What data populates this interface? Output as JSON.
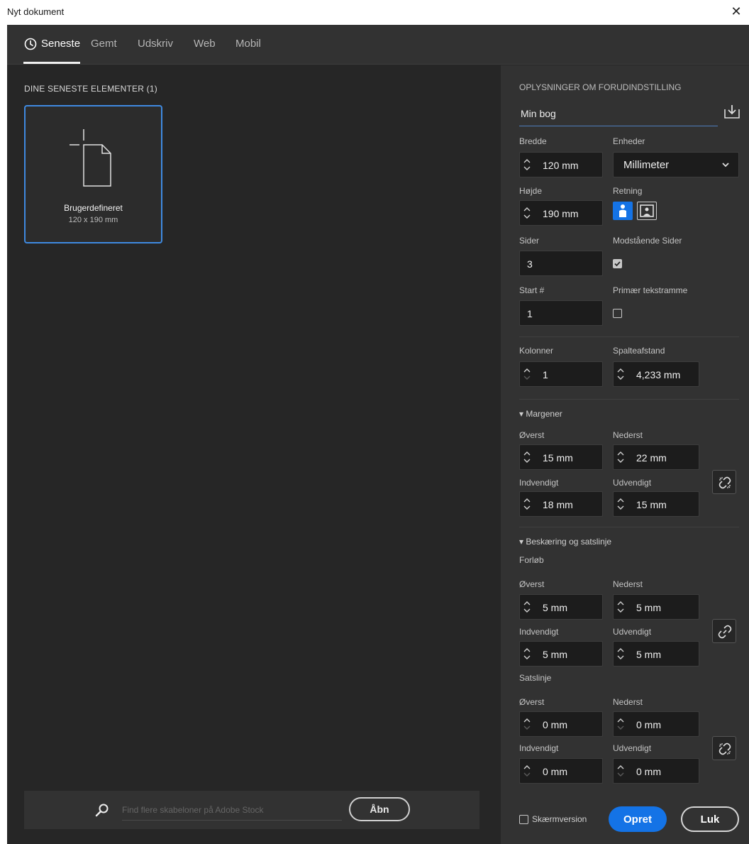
{
  "window": {
    "title": "Nyt dokument",
    "close_glyph": "✕"
  },
  "tabs": [
    {
      "label": "Seneste",
      "active": true,
      "icon": "clock-icon"
    },
    {
      "label": "Gemt"
    },
    {
      "label": "Udskriv"
    },
    {
      "label": "Web"
    },
    {
      "label": "Mobil"
    }
  ],
  "recent": {
    "header": "DINE SENESTE ELEMENTER  (1)",
    "items": [
      {
        "name": "Brugerdefineret",
        "size": "120 x 190 mm",
        "icon": "new-document-icon"
      }
    ]
  },
  "search": {
    "placeholder": "Find flere skabeloner på Adobe Stock",
    "open_label": "Åbn"
  },
  "preset": {
    "header": "OPLYSNINGER OM FORUDINDSTILLING",
    "name": "Min bog",
    "save_icon": "save-preset-icon",
    "width_label": "Bredde",
    "width": "120 mm",
    "units_label": "Enheder",
    "units": "Millimeter",
    "height_label": "Højde",
    "height": "190 mm",
    "orientation_label": "Retning",
    "orientation": "portrait",
    "pages_label": "Sider",
    "pages": "3",
    "facing_label": "Modstående Sider",
    "facing": true,
    "start_label": "Start #",
    "start": "1",
    "primary_frame_label": "Primær tekstramme",
    "primary_frame": false,
    "columns_label": "Kolonner",
    "columns": "1",
    "gutter_label": "Spalteafstand",
    "gutter": "4,233 mm"
  },
  "margins": {
    "title": "Margener",
    "top_label": "Øverst",
    "top": "15 mm",
    "bottom_label": "Nederst",
    "bottom": "22 mm",
    "inside_label": "Indvendigt",
    "inside": "18 mm",
    "outside_label": "Udvendigt",
    "outside": "15 mm"
  },
  "bleed_slug": {
    "title": "Beskæring og satslinje",
    "bleed_label": "Forløb",
    "bleed": {
      "top_label": "Øverst",
      "top": "5 mm",
      "bottom_label": "Nederst",
      "bottom": "5 mm",
      "inside_label": "Indvendigt",
      "inside": "5 mm",
      "outside_label": "Udvendigt",
      "outside": "5 mm"
    },
    "slug_label": "Satslinje",
    "slug": {
      "top_label": "Øverst",
      "top": "0 mm",
      "bottom_label": "Nederst",
      "bottom": "0 mm",
      "inside_label": "Indvendigt",
      "inside": "0 mm",
      "outside_label": "Udvendigt",
      "outside": "0 mm"
    }
  },
  "footer": {
    "screen_label": "Skærmversion",
    "screen_checked": false,
    "create_label": "Opret",
    "close_label": "Luk"
  },
  "colors": {
    "accent": "#1473e6",
    "panel": "#323232",
    "background": "#262626"
  }
}
